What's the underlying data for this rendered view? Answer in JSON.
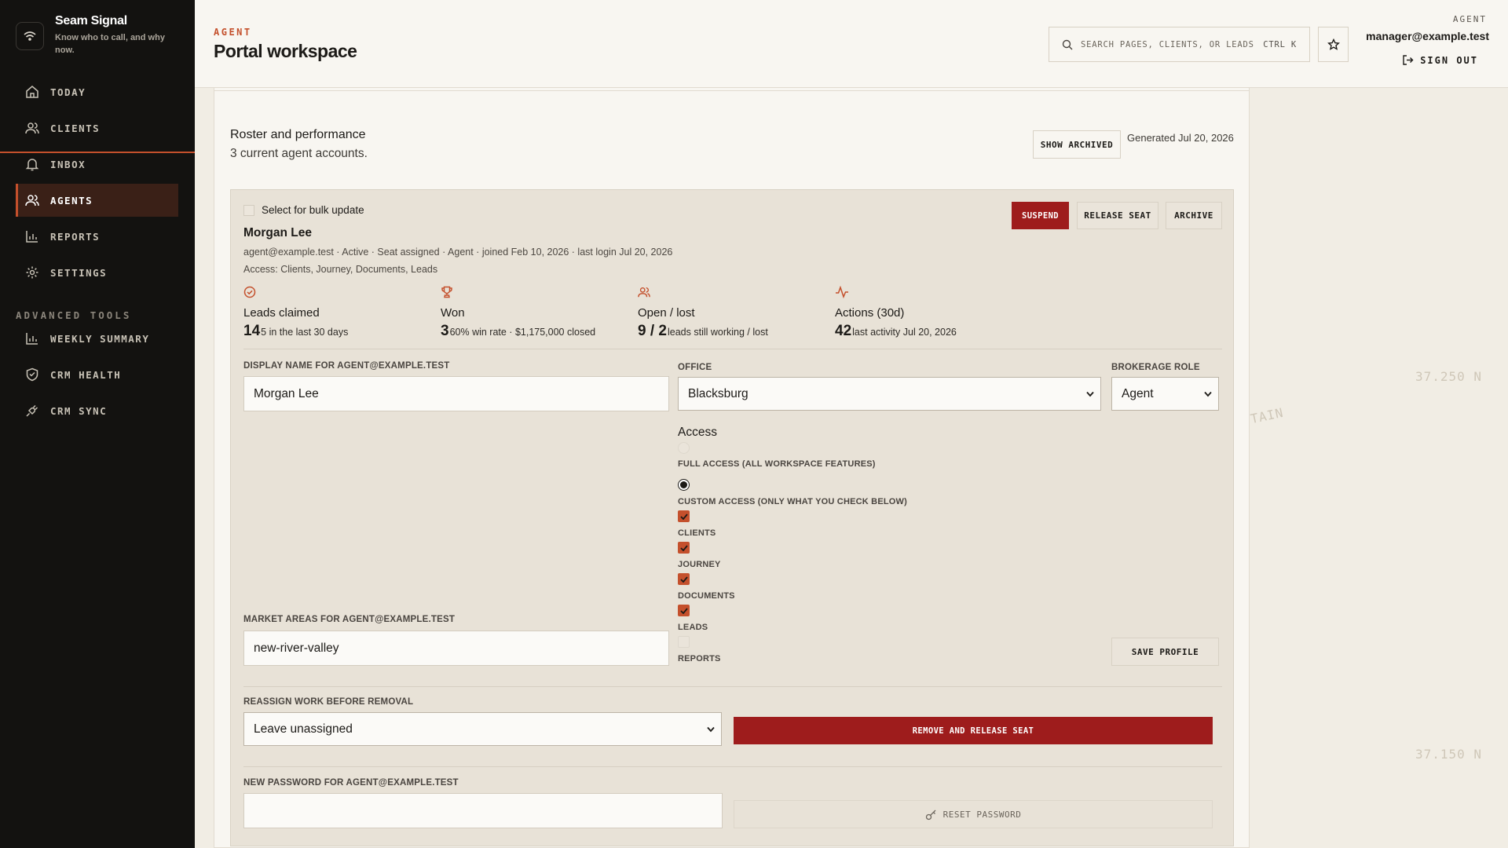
{
  "brand": {
    "name": "Seam Signal",
    "tagline": "Know who to call, and why now."
  },
  "sidebar": {
    "items": [
      {
        "label": "TODAY",
        "icon": "home-icon"
      },
      {
        "label": "CLIENTS",
        "icon": "users-icon"
      },
      {
        "label": "INBOX",
        "icon": "bell-icon"
      },
      {
        "label": "AGENTS",
        "icon": "users-icon",
        "active": true
      },
      {
        "label": "REPORTS",
        "icon": "bar-chart-icon"
      },
      {
        "label": "SETTINGS",
        "icon": "gear-icon"
      }
    ],
    "section_label": "ADVANCED TOOLS",
    "advanced": [
      {
        "label": "WEEKLY SUMMARY",
        "icon": "bar-chart-icon"
      },
      {
        "label": "CRM HEALTH",
        "icon": "shield-heart-icon"
      },
      {
        "label": "CRM SYNC",
        "icon": "plug-icon"
      }
    ]
  },
  "header": {
    "eyebrow": "AGENT",
    "title": "Portal workspace",
    "search_placeholder": "SEARCH PAGES, CLIENTS, OR LEADS",
    "search_shortcut": "CTRL K",
    "role": "AGENT",
    "email": "manager@example.test",
    "signout": "SIGN OUT"
  },
  "roster": {
    "title": "Roster and performance",
    "subtitle": "3 current agent accounts.",
    "show_archived": "SHOW ARCHIVED",
    "generated": "Generated Jul 20, 2026"
  },
  "agent": {
    "bulk_label": "Select for bulk update",
    "suspend": "SUSPEND",
    "release_seat": "RELEASE SEAT",
    "archive": "ARCHIVE",
    "name": "Morgan Lee",
    "meta": "agent@example.test · Active · Seat assigned · Agent · joined Feb 10, 2026 · last login Jul 20, 2026",
    "access": "Access: Clients, Journey, Documents, Leads",
    "stats": [
      {
        "label": "Leads claimed",
        "value": "14",
        "detail": "5 in the last 30 days",
        "icon": "check-circle-icon"
      },
      {
        "label": "Won",
        "value": "3",
        "detail": "60% win rate · $1,175,000 closed",
        "icon": "trophy-icon"
      },
      {
        "label": "Open / lost",
        "value": "9 / 2",
        "detail": "leads still working / lost",
        "icon": "users-icon"
      },
      {
        "label": "Actions (30d)",
        "value": "42",
        "detail": "last activity Jul 20, 2026",
        "icon": "activity-icon"
      }
    ],
    "display_name_label": "DISPLAY NAME FOR AGENT@EXAMPLE.TEST",
    "display_name": "Morgan Lee",
    "office_label": "OFFICE",
    "office": "Blacksburg",
    "role_label": "BROKERAGE ROLE",
    "role": "Agent",
    "access_title": "Access",
    "full_access": "FULL ACCESS (ALL WORKSPACE FEATURES)",
    "custom_access": "CUSTOM ACCESS (ONLY WHAT YOU CHECK BELOW)",
    "perm_clients": "CLIENTS",
    "perm_journey": "JOURNEY",
    "perm_documents": "DOCUMENTS",
    "perm_leads": "LEADS",
    "perm_reports": "REPORTS",
    "market_label": "MARKET AREAS FOR AGENT@EXAMPLE.TEST",
    "market": "new-river-valley",
    "save_profile": "SAVE PROFILE",
    "reassign_label": "REASSIGN WORK BEFORE REMOVAL",
    "reassign": "Leave unassigned",
    "remove": "REMOVE AND RELEASE SEAT",
    "password_label": "NEW PASSWORD FOR AGENT@EXAMPLE.TEST",
    "reset_password": "RESET PASSWORD"
  },
  "background": {
    "coord1": "37.250 N",
    "coord2": "37.150 N",
    "place": "TAIN"
  }
}
